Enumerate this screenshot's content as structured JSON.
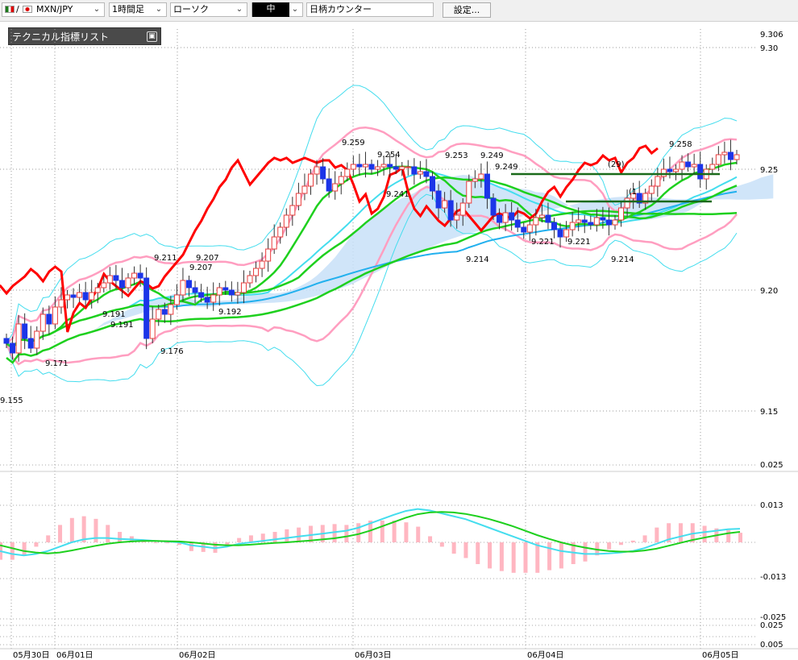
{
  "toolbar": {
    "pair": "MXN/JPY",
    "timeframe": "1時間足",
    "chart_style": "ローソク",
    "size": "中",
    "counter": "日柄カウンター",
    "settings": "設定..."
  },
  "panel": {
    "title": "テクニカル指標リスト",
    "button": "▣"
  },
  "colors": {
    "up": "#e83b3b",
    "down": "#1c35e8",
    "bb": "#44ddee",
    "bb2": "#ff9ec0",
    "ma": "#1ed01e",
    "ema": "#22b0ee",
    "kumo": "#c8e0f8",
    "chikou": "#ff0000",
    "macd": "#44ddee",
    "signal": "#1ed01e",
    "hist": "#ffb6c1"
  },
  "chart_data": [
    {
      "type": "candlestick",
      "price_axis": {
        "ticks": [
          "9.30",
          "9.25",
          "9.20",
          "9.15"
        ],
        "current": "9.306",
        "ylim": [
          9.15,
          9.3
        ]
      },
      "x_labels": [
        "05月30日",
        "06月01日",
        "06月02日",
        "06月03日",
        "06月04日",
        "06月05日"
      ],
      "annotations": [
        "9.155",
        "9.171",
        "9.191",
        "9.191",
        "9.211",
        "9.207",
        "9.207",
        "9.176",
        "9.192",
        "9.259",
        "9.254",
        "9.241",
        "9.253",
        "9.249",
        "9.249",
        "9.214",
        "9.221",
        "9.221",
        "9.214",
        "9.258",
        "(29)",
        "(1"
      ],
      "series": [
        {
          "name": "close",
          "values": [
            9.178,
            9.174,
            9.186,
            9.18,
            9.176,
            9.183,
            9.19,
            9.186,
            9.193,
            9.196,
            9.198,
            9.197,
            9.199,
            9.196,
            9.199,
            9.201,
            9.203,
            9.206,
            9.204,
            9.201,
            9.205,
            9.207,
            9.205,
            9.18,
            9.188,
            9.192,
            9.19,
            9.194,
            9.198,
            9.204,
            9.201,
            9.199,
            9.197,
            9.195,
            9.198,
            9.201,
            9.2,
            9.198,
            9.199,
            9.203,
            9.206,
            9.209,
            9.212,
            9.217,
            9.222,
            9.226,
            9.231,
            9.235,
            9.24,
            9.243,
            9.248,
            9.251,
            9.246,
            9.241,
            9.244,
            9.247,
            9.25,
            9.252,
            9.251,
            9.252,
            9.25,
            9.251,
            9.252,
            9.251,
            9.25,
            9.251,
            9.251,
            9.248,
            9.249,
            9.247,
            9.241,
            9.234,
            9.237,
            9.229,
            9.231,
            9.236,
            9.245,
            9.246,
            9.248,
            9.238,
            9.231,
            9.228,
            9.232,
            9.229,
            9.226,
            9.224,
            9.227,
            9.23,
            9.231,
            9.228,
            9.225,
            9.222,
            9.225,
            9.228,
            9.229,
            9.228,
            9.227,
            9.23,
            9.229,
            9.227,
            9.229,
            9.234,
            9.238,
            9.24,
            9.236,
            9.24,
            9.243,
            9.247,
            9.25,
            9.249,
            9.25,
            9.253,
            9.251,
            9.252,
            9.246,
            9.25,
            9.252,
            9.256,
            9.257,
            9.254,
            9.256
          ]
        },
        {
          "name": "MACD",
          "values": [
            -0.003,
            -0.004,
            -0.0045,
            -0.004,
            -0.003,
            -0.0015,
            0.0,
            0.001,
            0.0015,
            0.0015,
            0.0012,
            0.001,
            0.0008,
            0.0005,
            0.0003,
            0.0,
            -0.001,
            -0.0015,
            -0.002,
            -0.0015,
            -0.0005,
            0.0,
            0.0005,
            0.001,
            0.0015,
            0.002,
            0.0025,
            0.003,
            0.0035,
            0.004,
            0.005,
            0.0065,
            0.008,
            0.0095,
            0.0108,
            0.0115,
            0.011,
            0.01,
            0.009,
            0.008,
            0.0065,
            0.005,
            0.0035,
            0.002,
            0.0005,
            -0.001,
            -0.002,
            -0.003,
            -0.0035,
            -0.004,
            -0.004,
            -0.0038,
            -0.0035,
            -0.003,
            -0.002,
            -0.0005,
            0.001,
            0.002,
            0.003,
            0.0035,
            0.004,
            0.0045,
            0.0047
          ]
        },
        {
          "name": "Signal",
          "values": [
            -0.001,
            -0.002,
            -0.003,
            -0.0035,
            -0.0038,
            -0.0035,
            -0.0028,
            -0.002,
            -0.0012,
            -0.0005,
            0.0,
            0.0003,
            0.0005,
            0.0005,
            0.0004,
            0.0003,
            0.0,
            -0.0004,
            -0.0008,
            -0.001,
            -0.001,
            -0.0008,
            -0.0005,
            -0.0002,
            0.0,
            0.0003,
            0.0006,
            0.001,
            0.0014,
            0.002,
            0.0028,
            0.004,
            0.0055,
            0.007,
            0.0085,
            0.0097,
            0.0103,
            0.0105,
            0.0103,
            0.0098,
            0.009,
            0.008,
            0.0068,
            0.0055,
            0.004,
            0.0025,
            0.0012,
            0.0,
            -0.001,
            -0.0018,
            -0.0025,
            -0.003,
            -0.0032,
            -0.0032,
            -0.0028,
            -0.0022,
            -0.0012,
            -0.0002,
            0.0008,
            0.0016,
            0.0024,
            0.0031,
            0.0036
          ]
        }
      ],
      "oscillator_axis": {
        "ticks": [
          "0.025",
          "0.013",
          "-0.013",
          "-0.025",
          "0.025",
          "0.005"
        ]
      }
    }
  ]
}
